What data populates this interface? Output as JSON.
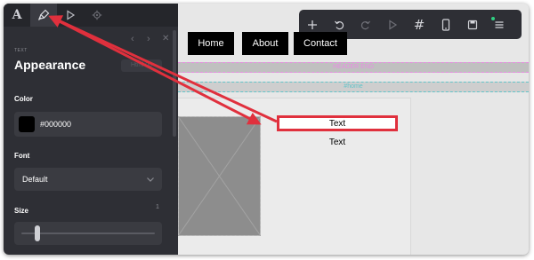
{
  "panel": {
    "tabs": [
      {
        "icon": "font-icon",
        "glyph": "A"
      },
      {
        "icon": "brush-icon"
      },
      {
        "icon": "play-icon"
      },
      {
        "icon": "gear-icon"
      }
    ],
    "active_tab": 1,
    "kicker": "TEXT",
    "title": "Appearance",
    "ghost_badge": "Html 00",
    "color": {
      "label": "Color",
      "value": "#000000",
      "swatch": "#000000"
    },
    "font": {
      "label": "Font",
      "selected": "Default"
    },
    "size": {
      "label": "Size",
      "value": "1",
      "slider_fraction": 0.12
    }
  },
  "toolbar": {
    "buttons": [
      "add-icon",
      "undo-icon",
      "redo-icon",
      "play-icon",
      "grid-icon",
      "mobile-icon",
      "save-icon",
      "menu-icon"
    ],
    "grid_glyph": "#",
    "status_dot_color": "#2fcf82"
  },
  "site_nav": [
    "Home",
    "About",
    "Contact"
  ],
  "markers": {
    "header_end": "HEADER END",
    "home": "#home",
    "header_color": "#e98de3",
    "home_color": "#63c4c9"
  },
  "canvas": {
    "selected_text": "Text",
    "text": "Text",
    "highlight_color": "#e0303d"
  }
}
